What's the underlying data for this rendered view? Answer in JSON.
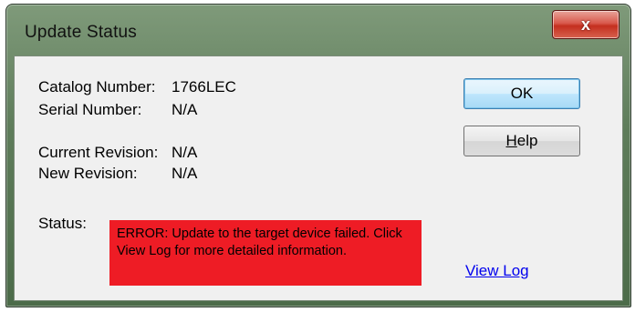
{
  "window": {
    "title": "Update Status",
    "close_label": "x"
  },
  "fields": {
    "catalog_label": "Catalog Number:",
    "catalog_value": "1766LEC",
    "serial_label": "Serial Number:",
    "serial_value": "N/A",
    "current_rev_label": "Current Revision:",
    "current_rev_value": "N/A",
    "new_rev_label": "New Revision:",
    "new_rev_value": "N/A",
    "status_label": "Status:",
    "status_message": "ERROR: Update to the target device failed. Click View Log for more detailed information."
  },
  "buttons": {
    "ok_label": "OK",
    "help_label": "Help"
  },
  "links": {
    "view_log_label": "View Log"
  },
  "colors": {
    "error_background": "#ee1c25",
    "link": "#0000ee"
  }
}
